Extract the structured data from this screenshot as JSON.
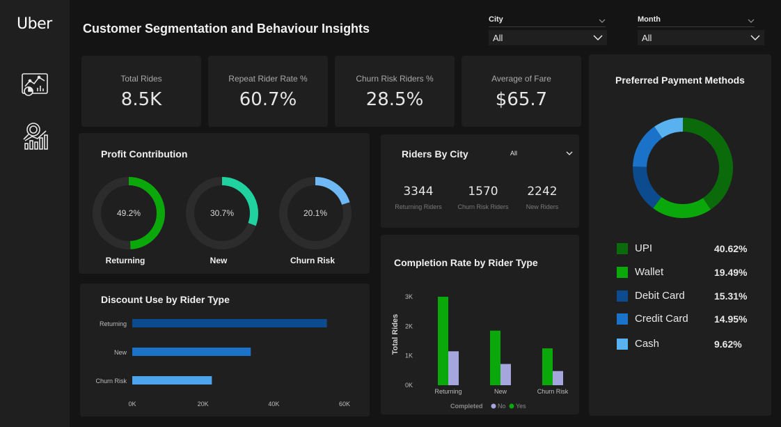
{
  "app": {
    "logo": "Uber",
    "title": "Customer Segmentation and Behaviour Insights"
  },
  "colors": {
    "background": "#141414",
    "card": "#1f1f1f",
    "sidebar": "#1f1f1f",
    "green_dark": "#0b6b0b",
    "green": "#0aa80a",
    "blue_dark": "#0d4b8f",
    "blue": "#1a73c9",
    "blue_light": "#5ab1f0",
    "teal": "#20d2a0",
    "lavender": "#a4a6dd"
  },
  "sidebar": {
    "items": [
      {
        "icon": "dashboard-report-icon"
      },
      {
        "icon": "analytics-search-icon"
      }
    ]
  },
  "filters": {
    "city": {
      "label": "City",
      "value": "All"
    },
    "month": {
      "label": "Month",
      "value": "All"
    }
  },
  "kpis": [
    {
      "label": "Total Rides",
      "value": "8.5K"
    },
    {
      "label": "Repeat Rider Rate %",
      "value": "60.7%"
    },
    {
      "label": "Churn Risk Riders %",
      "value": "28.5%"
    },
    {
      "label": "Average of Fare",
      "value": "$65.7"
    }
  ],
  "profit": {
    "title": "Profit Contribution",
    "gauges": [
      {
        "label": "Returning",
        "value": 49.2,
        "text": "49.2%",
        "color": "#0aa80a"
      },
      {
        "label": "New",
        "value": 30.7,
        "text": "30.7%",
        "color": "#20d2a0"
      },
      {
        "label": "Churn Risk",
        "value": 20.1,
        "text": "20.1%",
        "color": "#6db8f5"
      }
    ]
  },
  "riders_by_city": {
    "title": "Riders By City",
    "filter_value": "All",
    "stats": [
      {
        "value": "3344",
        "label": "Returning Riders"
      },
      {
        "value": "1570",
        "label": "Churn Risk Riders"
      },
      {
        "value": "2242",
        "label": "New Riders"
      }
    ]
  },
  "chart_data": [
    {
      "id": "discount",
      "type": "bar",
      "orientation": "horizontal",
      "title": "Discount Use by Rider Type",
      "categories": [
        "Returning",
        "New",
        "Churn Risk"
      ],
      "values": [
        55000,
        33500,
        22500
      ],
      "colors": [
        "#0d4b8f",
        "#1a73c9",
        "#4da3ec"
      ],
      "xlim": [
        0,
        60000
      ],
      "xticks": [
        "0K",
        "20K",
        "40K",
        "60K"
      ]
    },
    {
      "id": "completion",
      "type": "bar",
      "title": "Completion Rate by Rider Type",
      "ylabel": "Total Rides",
      "categories": [
        "Returning",
        "New",
        "Churn Risk"
      ],
      "series": [
        {
          "name": "Yes",
          "values": [
            3000,
            1850,
            1250
          ],
          "color": "#0aa80a"
        },
        {
          "name": "No",
          "values": [
            1150,
            720,
            480
          ],
          "color": "#a4a6dd"
        }
      ],
      "ylim": [
        0,
        3200
      ],
      "yticks": [
        "0K",
        "1K",
        "2K",
        "3K"
      ],
      "legend": {
        "title": "Completed",
        "items": [
          "No",
          "Yes"
        ]
      }
    },
    {
      "id": "payment",
      "type": "pie",
      "title": "Preferred Payment Methods",
      "slices": [
        {
          "name": "UPI",
          "value": 40.62,
          "text": "40.62%",
          "color": "#0b6b0b"
        },
        {
          "name": "Wallet",
          "value": 19.49,
          "text": "19.49%",
          "color": "#0aa80a"
        },
        {
          "name": "Debit Card",
          "value": 15.31,
          "text": "15.31%",
          "color": "#0d4b8f"
        },
        {
          "name": "Credit Card",
          "value": 14.95,
          "text": "14.95%",
          "color": "#1a73c9"
        },
        {
          "name": "Cash",
          "value": 9.62,
          "text": "9.62%",
          "color": "#5ab1f0"
        }
      ]
    }
  ]
}
